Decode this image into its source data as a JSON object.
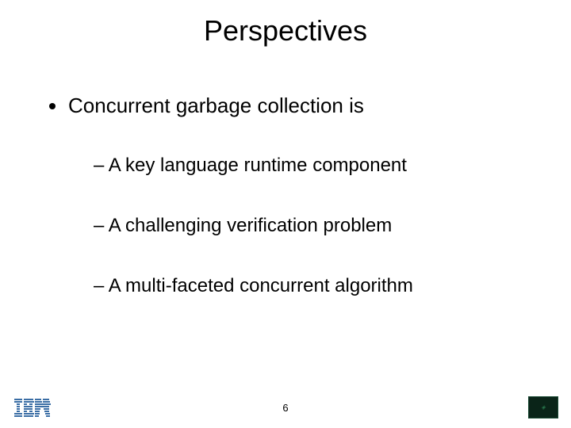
{
  "title": "Perspectives",
  "bullet": {
    "text": "Concurrent garbage collection is",
    "subs": [
      "– A key language runtime component",
      "– A challenging verification problem",
      "– A multi-faceted concurrent algorithm"
    ]
  },
  "page_number": "6",
  "logos": {
    "left": "ibm-logo",
    "right": "decorative-badge"
  }
}
